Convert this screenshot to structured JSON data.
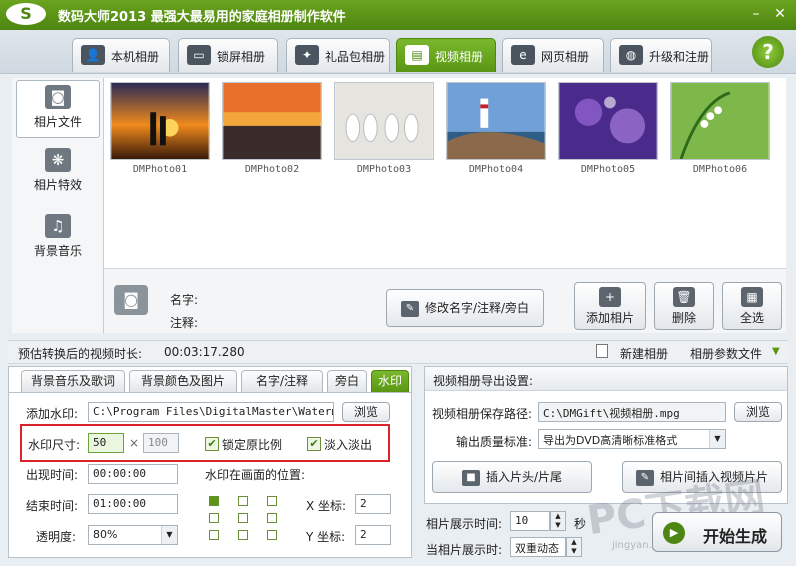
{
  "window": {
    "logo": "S",
    "title": "数码大师2013    最强大最易用的家庭相册制作软件"
  },
  "main_tabs": [
    {
      "label": "本机相册",
      "icon": "user-photo-icon",
      "glyph": "👤"
    },
    {
      "label": "锁屏相册",
      "icon": "monitor-icon",
      "glyph": "▭"
    },
    {
      "label": "礼品包相册",
      "icon": "gift-icon",
      "glyph": "✦"
    },
    {
      "label": "视频相册",
      "icon": "film-icon",
      "glyph": "▤",
      "active": true
    },
    {
      "label": "网页相册",
      "icon": "ie-browser-icon",
      "glyph": "e"
    },
    {
      "label": "升级和注册",
      "icon": "globe-icon",
      "glyph": "◍"
    }
  ],
  "help_label": "?",
  "left_nav": [
    {
      "label": "相片文件",
      "icon": "camera-icon",
      "glyph": "◙",
      "active": true
    },
    {
      "label": "相片特效",
      "icon": "effects-icon",
      "glyph": "❋"
    },
    {
      "label": "背景音乐",
      "icon": "music-note-icon",
      "glyph": "♫"
    }
  ],
  "photos": [
    {
      "name": "DMPhoto01",
      "scene": "sunset-couple"
    },
    {
      "name": "DMPhoto02",
      "scene": "sunset-sea"
    },
    {
      "name": "DMPhoto03",
      "scene": "slippers"
    },
    {
      "name": "DMPhoto04",
      "scene": "lighthouse"
    },
    {
      "name": "DMPhoto05",
      "scene": "purple-bokeh"
    },
    {
      "name": "DMPhoto06",
      "scene": "lily-of-valley"
    }
  ],
  "info": {
    "camera_glyph": "◙",
    "name_label": "名字:",
    "note_label": "注释:",
    "edit_button": "修改名字/注释/旁白",
    "add_photo": "添加相片",
    "delete": "删除",
    "select_all": "全选"
  },
  "status": {
    "duration_label": "预估转换后的视频时长:",
    "duration_value": "00:03:17.280",
    "new_album": "新建相册",
    "album_params": "相册参数文件"
  },
  "sub_tabs": [
    {
      "label": "背景音乐及歌词"
    },
    {
      "label": "背景颜色及图片"
    },
    {
      "label": "名字/注释"
    },
    {
      "label": "旁白"
    },
    {
      "label": "水印",
      "active": true
    }
  ],
  "watermark": {
    "add_label": "添加水印:",
    "path_value": "C:\\Program Files\\DigitalMaster\\Watermark",
    "browse": "浏览",
    "size_label": "水印尺寸:",
    "width_value": "50",
    "times": "×",
    "height_value": "100",
    "lock_ratio": "锁定原比例",
    "lock_ratio_checked": true,
    "fade": "淡入淡出",
    "fade_checked": true,
    "check_glyph": "✔",
    "appear_label": "出现时间:",
    "appear_value": "00:00:00",
    "end_label": "结束时间:",
    "end_value": "01:00:00",
    "opacity_label": "透明度:",
    "opacity_value": "80%",
    "position_label": "水印在画面的位置:",
    "x_label": "X 坐标:",
    "x_value": "2",
    "y_label": "Y 坐标:",
    "y_value": "2"
  },
  "export": {
    "heading": "视频相册导出设置:",
    "path_label": "视频相册保存路径:",
    "path_value": "C:\\DMGift\\视频相册.mpg",
    "browse": "浏览",
    "quality_label": "输出质量标准:",
    "quality_value": "导出为DVD高清晰标准格式",
    "insert_head": "插入片头/片尾",
    "insert_between": "相片间插入视频片片"
  },
  "timing": {
    "show_time_label": "相片展示时间:",
    "show_time_value": "10",
    "seconds": "秒",
    "show_mode_label": "当相片展示时:",
    "show_mode_value": "双重动态"
  },
  "generate": {
    "label": "开始生成",
    "glyph": "▶"
  },
  "watermark_overlay": {
    "text": "PC下载网",
    "url": "jingyan.pcsoft.com.cn"
  },
  "colors": {
    "brand_green": "#5a9614",
    "highlight_red": "#d8242a"
  }
}
